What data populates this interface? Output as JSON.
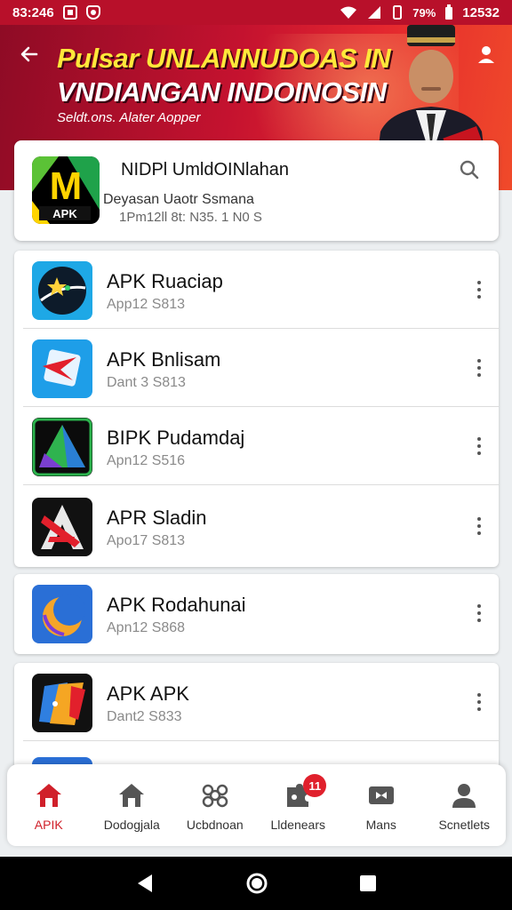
{
  "status_bar": {
    "time": "83:246",
    "battery_text": "79%",
    "clock_right": "12532"
  },
  "hero": {
    "title_line1": "Pulsar UNLANNUDOAS IN",
    "title_line2": "VNDIANGAN INDOINOSIN",
    "subtitle": "Seldt.ons. Alater Aopper"
  },
  "featured": {
    "title": "NIDPl UmldOINlahan",
    "line1": "Deyasan Uaotr Ssmana",
    "line2": "1Pm12ll 8t: N35. 1 N0 S",
    "icon_label": "APK"
  },
  "apps": [
    {
      "name": "APK Ruaciap",
      "meta": "App12 S813",
      "icon": "star-dark-icon"
    },
    {
      "name": "APK Bnlisam",
      "meta": "Dant 3 S813",
      "icon": "red-arrow-blue-icon"
    },
    {
      "name": "BIPK Pudamdaj",
      "meta": "Apn12 S516",
      "icon": "green-triangle-icon"
    },
    {
      "name": "APR Sladin",
      "meta": "Apo17 S813",
      "icon": "red-a-dark-icon"
    },
    {
      "name": "APK Rodahunai",
      "meta": "Apn12 S868",
      "icon": "crescent-blue-icon"
    },
    {
      "name": "APK APK",
      "meta": "Dant2 S833",
      "icon": "orange-folds-icon"
    }
  ],
  "bottom_nav": [
    {
      "label": "APIK",
      "icon": "home-icon",
      "active": true
    },
    {
      "label": "Dodogjala",
      "icon": "home-outline-icon",
      "active": false
    },
    {
      "label": "Ucbdnoan",
      "icon": "cluster-icon",
      "active": false
    },
    {
      "label": "Lldenears",
      "icon": "puzzle-icon",
      "active": false,
      "badge": "11"
    },
    {
      "label": "Mans",
      "icon": "media-icon",
      "active": false
    },
    {
      "label": "Scnetlets",
      "icon": "person-icon",
      "active": false
    }
  ],
  "colors": {
    "brand_red": "#c4122f",
    "accent_yellow": "#ffe83a",
    "badge_red": "#e0202c"
  }
}
